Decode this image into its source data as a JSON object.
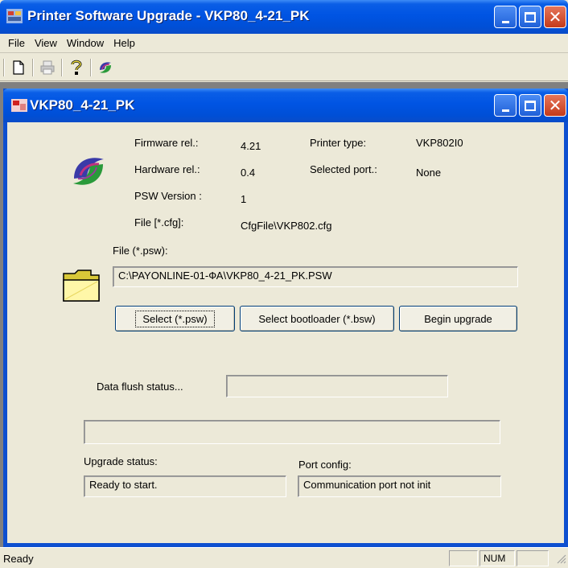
{
  "window": {
    "title": "Printer Software Upgrade - VKP80_4-21_PK"
  },
  "menu": {
    "items": [
      "File",
      "View",
      "Window",
      "Help"
    ]
  },
  "toolbar": {
    "buttons": [
      "new-document-icon",
      "print-icon",
      "help-icon",
      "app-logo-icon"
    ]
  },
  "child": {
    "title": "VKP80_4-21_PK",
    "info": {
      "firmware_label": "Firmware rel.:",
      "firmware_value": "4.21",
      "hardware_label": "Hardware rel.:",
      "hardware_value": "0.4",
      "psw_label": "PSW Version :",
      "psw_value": "1",
      "cfg_label": "File [*.cfg]:",
      "cfg_value": "CfgFile\\VKP802.cfg",
      "printer_type_label": "Printer type:",
      "printer_type_value": "VKP802I0",
      "port_label": "Selected port.:",
      "port_value": "None"
    },
    "file_psw_label": "File (*.psw):",
    "file_psw_value": "C:\\PAYONLINE-01-ФА\\VKP80_4-21_PK.PSW",
    "buttons": {
      "select_psw": "Select (*.psw)",
      "select_bootloader": "Select bootloader (*.bsw)",
      "begin_upgrade": "Begin upgrade"
    },
    "data_flush_label": "Data flush status...",
    "data_flush_value": "",
    "progress_value": "",
    "upgrade_status_label": "Upgrade status:",
    "upgrade_status_value": "Ready to start.",
    "port_config_label": "Port config:",
    "port_config_value": "Communication port not init"
  },
  "statusbar": {
    "text": "Ready",
    "num": "NUM"
  },
  "colors": {
    "titlebar": "#0054e3",
    "face": "#ece9d8",
    "mdi_bg": "#808080"
  }
}
